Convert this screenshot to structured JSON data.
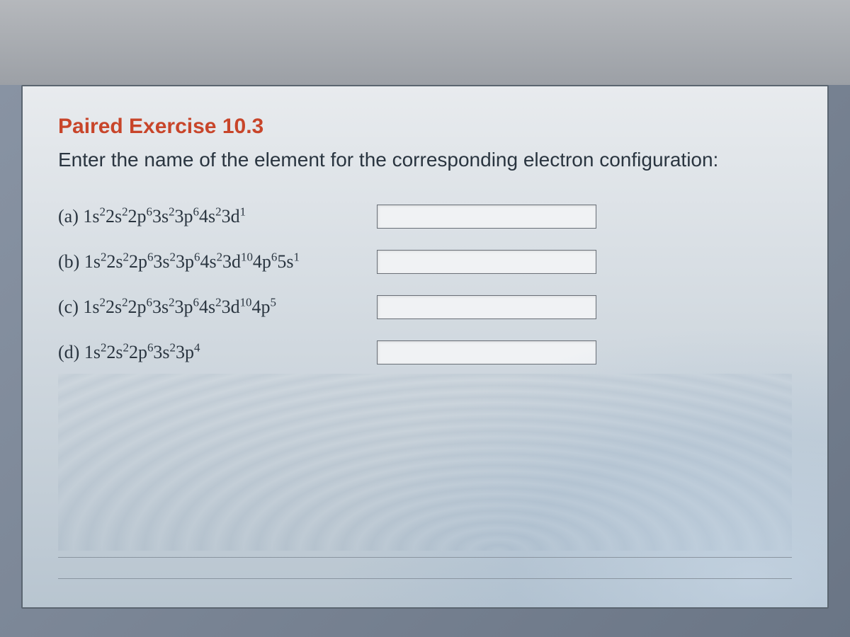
{
  "exercise": {
    "title": "Paired Exercise 10.3",
    "prompt": "Enter the name of the element for the corresponding electron configuration:"
  },
  "questions": [
    {
      "letter": "(a)",
      "config": [
        {
          "orbital": "1s",
          "sup": "2"
        },
        {
          "orbital": "2s",
          "sup": "2"
        },
        {
          "orbital": "2p",
          "sup": "6"
        },
        {
          "orbital": "3s",
          "sup": "2"
        },
        {
          "orbital": "3p",
          "sup": "6"
        },
        {
          "orbital": "4s",
          "sup": "2"
        },
        {
          "orbital": "3d",
          "sup": "1"
        }
      ],
      "answer": ""
    },
    {
      "letter": "(b)",
      "config": [
        {
          "orbital": "1s",
          "sup": "2"
        },
        {
          "orbital": "2s",
          "sup": "2"
        },
        {
          "orbital": "2p",
          "sup": "6"
        },
        {
          "orbital": "3s",
          "sup": "2"
        },
        {
          "orbital": "3p",
          "sup": "6"
        },
        {
          "orbital": "4s",
          "sup": "2"
        },
        {
          "orbital": "3d",
          "sup": "10"
        },
        {
          "orbital": "4p",
          "sup": "6"
        },
        {
          "orbital": "5s",
          "sup": "1"
        }
      ],
      "answer": ""
    },
    {
      "letter": "(c)",
      "config": [
        {
          "orbital": "1s",
          "sup": "2"
        },
        {
          "orbital": "2s",
          "sup": "2"
        },
        {
          "orbital": "2p",
          "sup": "6"
        },
        {
          "orbital": "3s",
          "sup": "2"
        },
        {
          "orbital": "3p",
          "sup": "6"
        },
        {
          "orbital": "4s",
          "sup": "2"
        },
        {
          "orbital": "3d",
          "sup": "10"
        },
        {
          "orbital": "4p",
          "sup": "5"
        }
      ],
      "answer": ""
    },
    {
      "letter": "(d)",
      "config": [
        {
          "orbital": "1s",
          "sup": "2"
        },
        {
          "orbital": "2s",
          "sup": "2"
        },
        {
          "orbital": "2p",
          "sup": "6"
        },
        {
          "orbital": "3s",
          "sup": "2"
        },
        {
          "orbital": "3p",
          "sup": "4"
        }
      ],
      "answer": ""
    }
  ]
}
